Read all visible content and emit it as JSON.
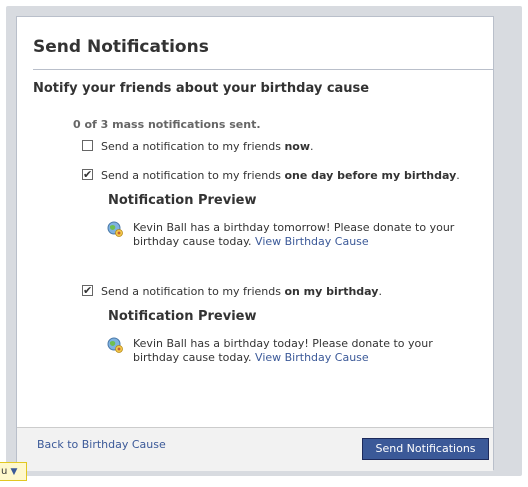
{
  "dialog": {
    "title": "Send Notifications",
    "subtitle": "Notify your friends about your birthday cause",
    "sent_count": "0 of 3 mass notifications sent."
  },
  "options": [
    {
      "checked": false,
      "prefix": "Send a notification to my friends ",
      "emphasis": "now",
      "suffix": "."
    },
    {
      "checked": true,
      "prefix": "Send a notification to my friends ",
      "emphasis": "one day before my birthday",
      "suffix": ".",
      "preview": {
        "title": "Notification Preview",
        "text": "Kevin Ball has a birthday tomorrow! Please donate to your birthday cause today. ",
        "link": "View Birthday Cause",
        "icon": "causes-globe-icon"
      }
    },
    {
      "checked": true,
      "prefix": "Send a notification to my friends ",
      "emphasis": "on my birthday",
      "suffix": ".",
      "preview": {
        "title": "Notification Preview",
        "text": "Kevin Ball has a birthday today! Please donate to your birthday cause today. ",
        "link": "View Birthday Cause",
        "icon": "causes-globe-icon"
      }
    }
  ],
  "footer": {
    "back_link": "Back to Birthday Cause",
    "send_button": "Send Notifications"
  },
  "bottom_tab": {
    "label": "u",
    "icon": "chevron-down-icon"
  },
  "colors": {
    "link": "#3b5998",
    "button_bg": "#3b5998",
    "dialog_border": "#b9bfca",
    "footer_bg": "#f2f2f2"
  }
}
